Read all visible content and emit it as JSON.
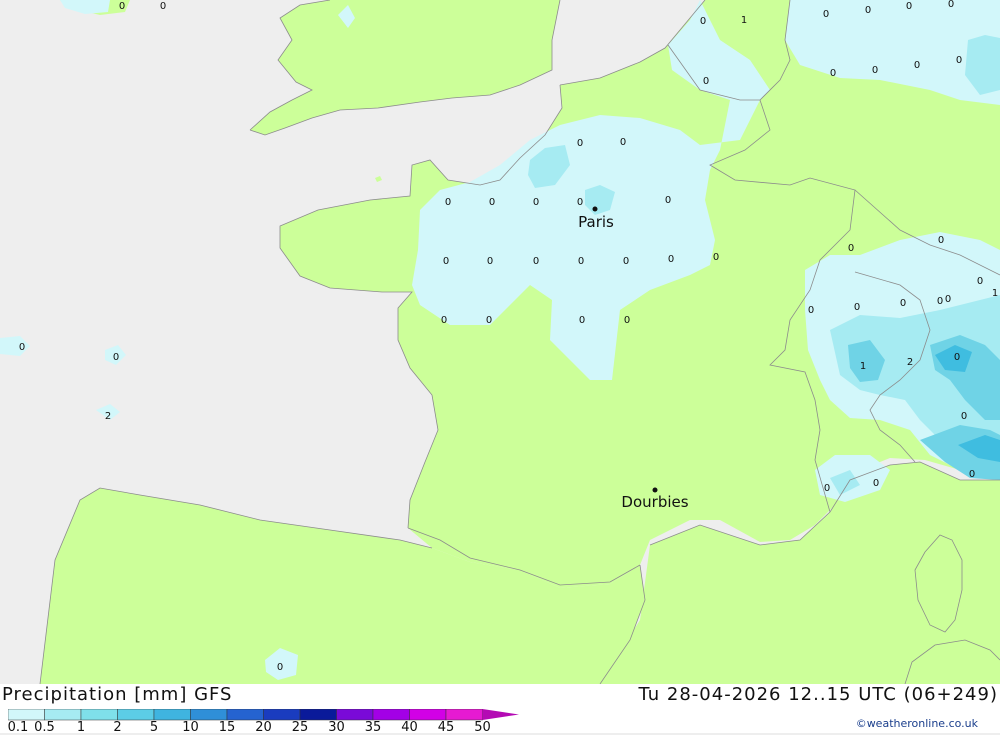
{
  "map": {
    "colors": {
      "sea": "#eeeeee",
      "land": "#ccff99",
      "precip_light": "#d2f7fa",
      "precip_mid": "#a6ebf2",
      "precip_high": "#6fd3e6",
      "precip_max": "#3fbde0"
    },
    "cities": [
      {
        "name": "Paris"
      },
      {
        "name": "Dourbies"
      }
    ],
    "value_labels": [
      "0",
      "0",
      "0",
      "1",
      "0",
      "0",
      "0",
      "0",
      "0",
      "0",
      "0",
      "0",
      "0",
      "0",
      "0",
      "0",
      "0",
      "0",
      "0",
      "0",
      "0",
      "0",
      "0",
      "0",
      "0",
      "0",
      "0",
      "0",
      "0",
      "0",
      "0",
      "0",
      "0",
      "0",
      "0",
      "0",
      "0",
      "1",
      "0",
      "0",
      "2",
      "1",
      "2",
      "0",
      "0",
      "0",
      "0",
      "0",
      "0",
      "0",
      "0"
    ]
  },
  "footer": {
    "title": "Precipitation [mm] GFS",
    "timestamp": "Tu 28-04-2026 12..15 UTC (06+249)",
    "credit": "©weatheronline.co.uk"
  },
  "legend": {
    "labels": [
      "0.1",
      "0.5",
      "1",
      "2",
      "5",
      "10",
      "15",
      "20",
      "25",
      "30",
      "35",
      "40",
      "45",
      "50"
    ],
    "colors": [
      "#d2f7fa",
      "#a6ebf2",
      "#7fe0ea",
      "#5ccde6",
      "#3fb4e0",
      "#2f8fd8",
      "#2563d0",
      "#1a3cbf",
      "#0a1a9a",
      "#7a0ad8",
      "#a300e6",
      "#d200e6",
      "#e61ad2",
      "#b40ab4"
    ]
  }
}
